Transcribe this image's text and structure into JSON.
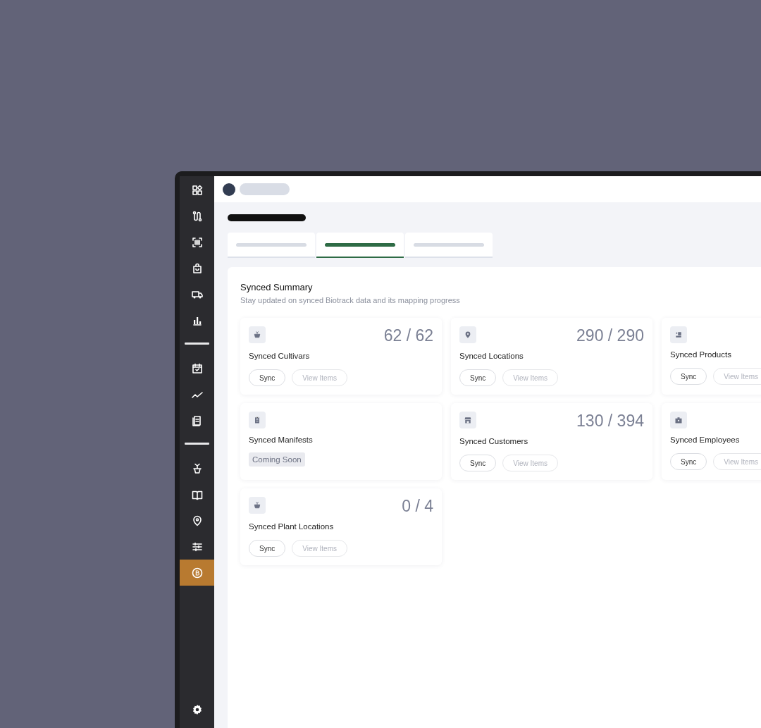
{
  "sidebar": {
    "groups": [
      [
        {
          "selected": false
        },
        {
          "selected": false
        },
        {
          "selected": false
        },
        {
          "selected": false
        },
        {
          "selected": false
        },
        {
          "selected": false
        }
      ],
      [
        {
          "selected": false
        },
        {
          "selected": false
        },
        {
          "selected": false
        }
      ],
      [
        {
          "selected": false
        },
        {
          "selected": false
        },
        {
          "selected": false
        },
        {
          "selected": false
        },
        {
          "selected": true
        }
      ]
    ]
  },
  "tabs": [
    {
      "selected": false
    },
    {
      "selected": true
    },
    {
      "selected": false
    }
  ],
  "summary": {
    "title": "Synced Summary",
    "subtitle": "Stay updated on synced Biotrack data and its mapping progress",
    "cards": [
      {
        "kind": "sync",
        "name": "Synced Cultivars",
        "count": "62 / 62",
        "buttons": [
          "Sync",
          "View Items"
        ]
      },
      {
        "kind": "sync",
        "name": "Synced Locations",
        "count": "290 / 290",
        "buttons": [
          "Sync",
          "View Items"
        ]
      },
      {
        "kind": "sync",
        "name": "Synced Products",
        "buttons": [
          "Sync",
          "View Items"
        ]
      },
      {
        "kind": "coming_soon",
        "name": "Synced Manifests",
        "badge": "Coming Soon"
      },
      {
        "kind": "sync",
        "name": "Synced Customers",
        "count": "130 / 394",
        "buttons": [
          "Sync",
          "View Items"
        ]
      },
      {
        "kind": "sync",
        "name": "Synced Employees",
        "buttons": [
          "Sync",
          "View Items"
        ]
      },
      {
        "kind": "sync",
        "name": "Synced Plant Locations",
        "count": "0 / 4",
        "buttons": [
          "Sync",
          "View Items"
        ]
      }
    ]
  }
}
